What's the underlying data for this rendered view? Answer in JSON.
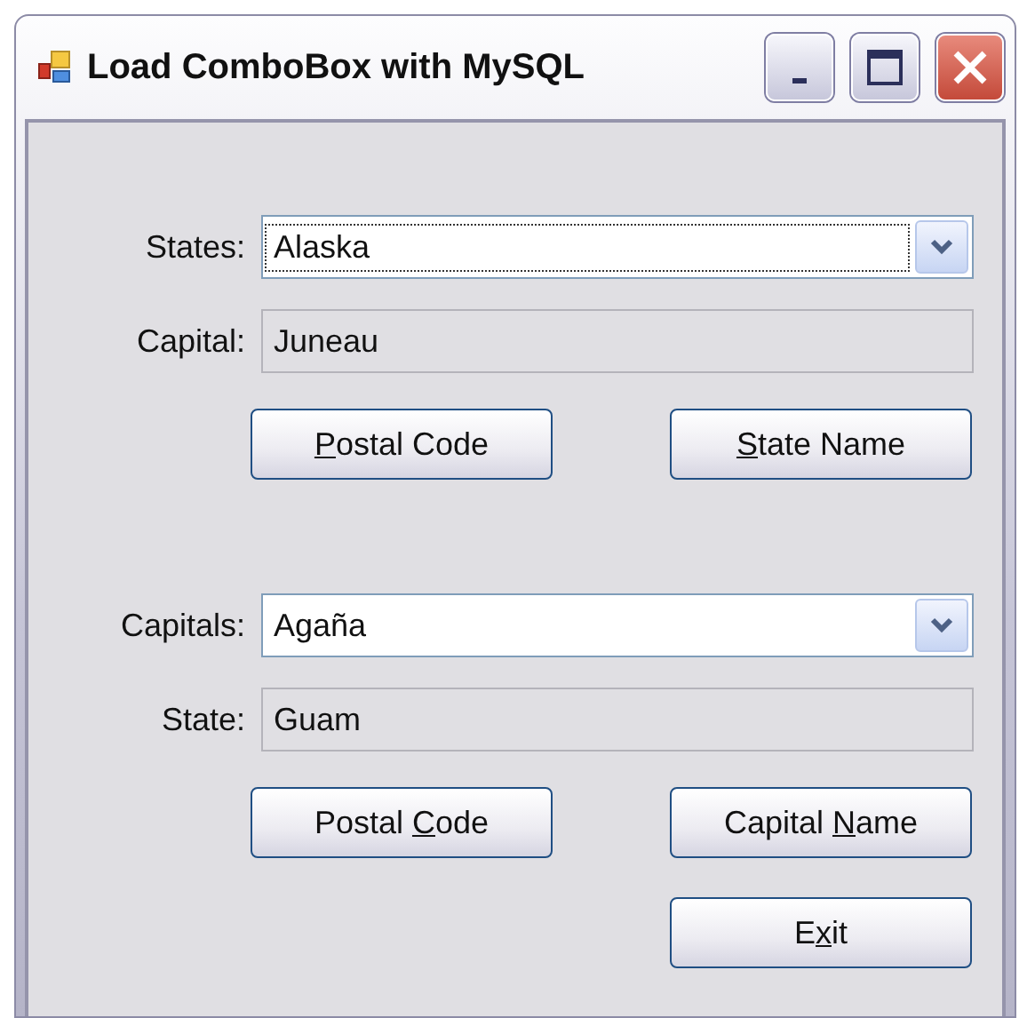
{
  "window": {
    "title": "Load ComboBox with MySQL"
  },
  "sections": [
    {
      "combo": {
        "label": "States:",
        "value": "Alaska",
        "focused": true
      },
      "field": {
        "label": "Capital:",
        "value": "Juneau"
      },
      "buttons": [
        {
          "key": "P",
          "after": "ostal Code"
        },
        {
          "key": "S",
          "after": "tate Name"
        }
      ]
    },
    {
      "combo": {
        "label": "Capitals:",
        "value": "Agaña",
        "focused": false
      },
      "field": {
        "label": "State:",
        "value": "Guam"
      },
      "buttons": [
        {
          "before": "Postal ",
          "key": "C",
          "after": "ode"
        },
        {
          "before": "Capital ",
          "key": "N",
          "after": "ame"
        }
      ]
    }
  ],
  "exit_button": {
    "before": "E",
    "key": "x",
    "after": "it"
  }
}
